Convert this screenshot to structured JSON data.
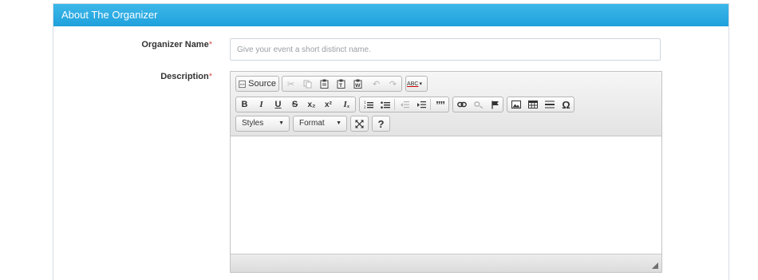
{
  "panel": {
    "title": "About The Organizer"
  },
  "organizer": {
    "label": "Organizer Name",
    "required_mark": "*",
    "placeholder": "Give your event a short distinct name.",
    "value": ""
  },
  "description": {
    "label": "Description",
    "required_mark": "*",
    "content": ""
  },
  "toolbar": {
    "source_label": "Source",
    "styles_label": "Styles",
    "format_label": "Format",
    "help_label": "?",
    "spellcheck_label": "ABC",
    "bold": "B",
    "italic": "I",
    "underline": "U",
    "strike": "S",
    "subscript": "x₂",
    "superscript": "x²",
    "remove_format": "Iₓ",
    "blockquote": "””",
    "special_char": "Ω",
    "cut_icon": "cut-icon",
    "copy_icon": "copy-icon",
    "paste_icon": "paste-icon"
  },
  "colors": {
    "header_top": "#3db7e9",
    "header_bottom": "#1fa1dc",
    "required": "#d9534f"
  }
}
